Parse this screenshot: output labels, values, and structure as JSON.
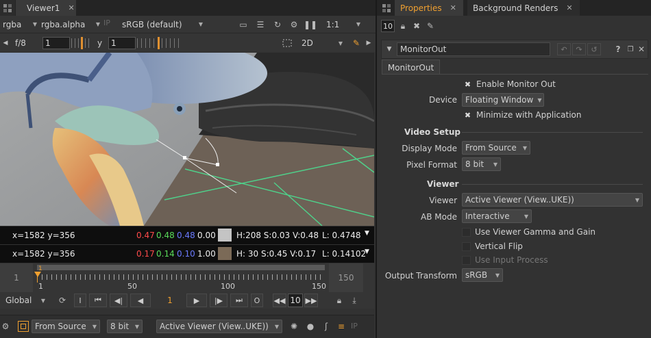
{
  "viewer": {
    "tab_label": "Viewer1",
    "channels": "rgba",
    "alpha": "rgba.alpha",
    "ip": "IP",
    "colorspace": "sRGB (default)",
    "zoom": "1:1",
    "fstop": "f/8",
    "gain_value": "1",
    "gamma_label": "y",
    "gamma_value": "1",
    "view_mode": "2D"
  },
  "pixel_rows": [
    {
      "coords": "x=1582 y=356",
      "r": "0.47",
      "g": "0.48",
      "b": "0.48",
      "a": "0.00",
      "swatch": "#c4c4c4",
      "hsv": "H:208 S:0.03 V:0.48",
      "l": "L: 0.4748"
    },
    {
      "coords": "x=1582 y=356",
      "r": "0.17",
      "g": "0.14",
      "b": "0.10",
      "a": "1.00",
      "swatch": "#7b6a57",
      "hsv": "H: 30 S:0.45 V:0.17",
      "l": "L: 0.14102"
    }
  ],
  "timeline": {
    "start": "1",
    "end": "150",
    "marker": "1",
    "ticks": [
      "1",
      "50",
      "100",
      "150"
    ],
    "scope": "Global",
    "current_frame": "1",
    "step": "10",
    "in_label": "I",
    "out_label": "O"
  },
  "bottom_bar": {
    "source": "From Source",
    "depth": "8 bit",
    "viewer": "Active Viewer (View..UKE))",
    "ip": "IP"
  },
  "properties": {
    "tabs": [
      "Properties",
      "Background Renders"
    ],
    "count": "10",
    "node_name": "MonitorOut",
    "node_tab": "MonitorOut",
    "enable_label": "Enable Monitor Out",
    "device_label": "Device",
    "device_value": "Floating Window",
    "minimize_label": "Minimize with Application",
    "video_setup": "Video Setup",
    "display_mode_label": "Display Mode",
    "display_mode_value": "From Source",
    "pixel_format_label": "Pixel Format",
    "pixel_format_value": "8 bit",
    "viewer_section": "Viewer",
    "viewer_label": "Viewer",
    "viewer_value": "Active Viewer (View..UKE))",
    "ab_mode_label": "AB Mode",
    "ab_mode_value": "Interactive",
    "gamma_gain_label": "Use Viewer Gamma and Gain",
    "vflip_label": "Vertical Flip",
    "input_process_label": "Use Input Process",
    "output_transform_label": "Output Transform",
    "output_transform_value": "sRGB"
  },
  "colors": {
    "accent": "#f0a030",
    "red": "#ff4a4a",
    "green": "#5adc5a",
    "blue": "#6a7aff"
  }
}
